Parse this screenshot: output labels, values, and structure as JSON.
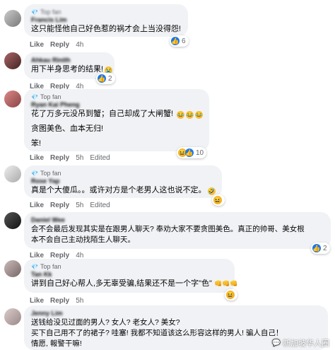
{
  "labels": {
    "top_fan": "Top fan",
    "like": "Like",
    "reply": "Reply",
    "edited": "Edited"
  },
  "comments": [
    {
      "top_fan": true,
      "name": "Francis Lim",
      "lines": [
        "这只能怪他自己好色惹的祸才会上当没得怨!"
      ],
      "time": "4h",
      "edited": false,
      "reactions": [
        "like"
      ],
      "count": "6"
    },
    {
      "top_fan": false,
      "name": "Ahkau Rinith",
      "lines": [
        "用下半身思考的结果!"
      ],
      "time": "4h",
      "edited": false,
      "reactions": [
        "like"
      ],
      "count": "2"
    },
    {
      "top_fan": true,
      "name": "Ryan Kai Pheng",
      "lines": [
        "花了万多元没吊到蟹；自己却成了大闸蟹!",
        "贪图美色、血本无归!",
        "笨!"
      ],
      "time": "5h",
      "edited": true,
      "reactions": [
        "haha",
        "like"
      ],
      "count": "10"
    },
    {
      "top_fan": true,
      "name": "Rose Yap",
      "lines": [
        "真是个大傻瓜。。或许对方是个老男人这也说不定。"
      ],
      "time": "5h",
      "edited": true,
      "reactions": [
        "haha"
      ],
      "count": ""
    },
    {
      "top_fan": false,
      "name": "Daniel Wee",
      "lines": [
        "会不会最后发现其实是在跟男人聊天? 奉劝大家不要贪图美色。真正的帅哥、美女根",
        "本不会自己主动找陌生人聊天。"
      ],
      "time": "4h",
      "edited": false,
      "reactions": [
        "like"
      ],
      "count": "2"
    },
    {
      "top_fan": true,
      "name": "Tan Kk",
      "lines": [
        "讲到自己好心帮人,多无辜受骗,结果还不是一个字\"色\""
      ],
      "time": "5h",
      "edited": false,
      "reactions": [
        "haha"
      ],
      "count": ""
    },
    {
      "top_fan": false,
      "name": "Jenny Lim",
      "lines": [
        "送钱给没见过面的男人? 女人? 老女人? 美女?",
        "买下自己用不了的裙子? 哇塞! 我都不知道该这么形容这样的男人! 骗人自己！",
        "情愿, 報警干嘛!"
      ],
      "time": "",
      "edited": false,
      "reactions": [],
      "count": ""
    }
  ],
  "watermark": "新加坡华人圈",
  "colors": {
    "bubble": "#f0f2f5",
    "meta": "#65676b",
    "like": "#1877f2",
    "haha": "#f7b125"
  }
}
